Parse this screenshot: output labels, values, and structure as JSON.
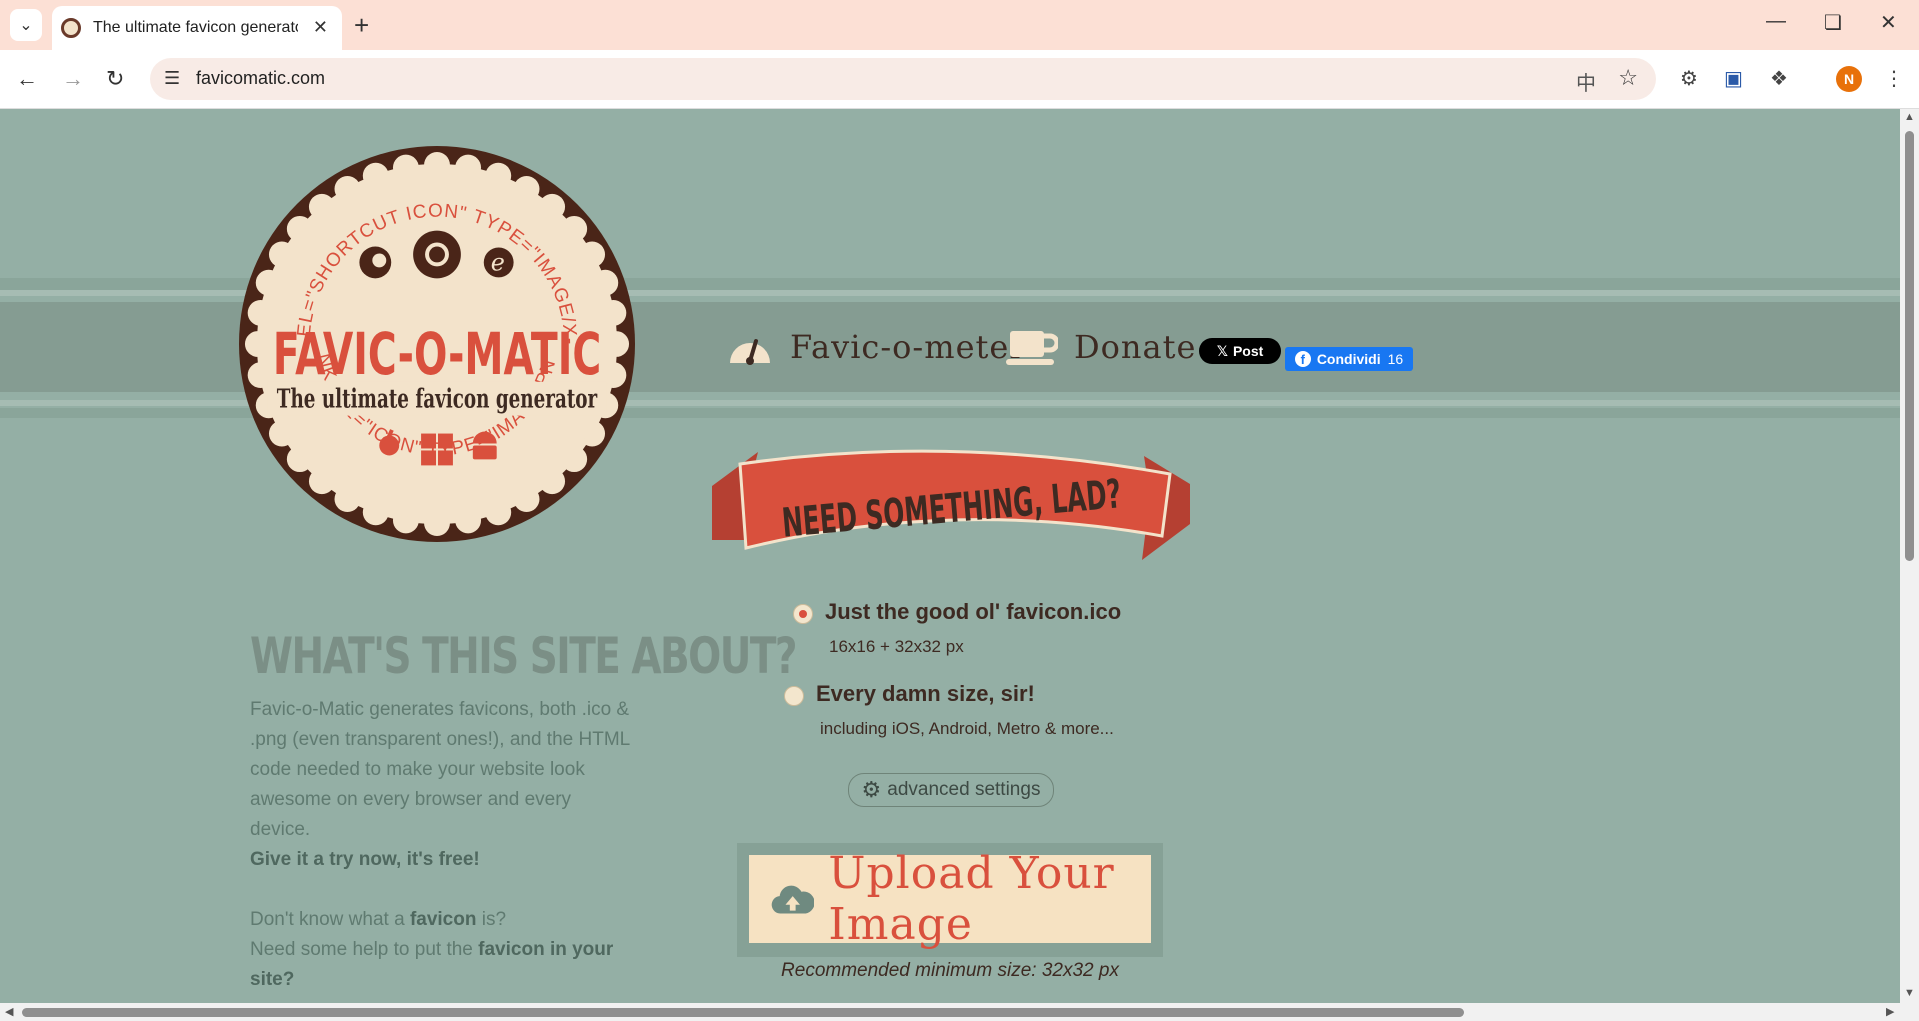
{
  "browser": {
    "tab_title": "The ultimate favicon generator",
    "url": "favicomatic.com",
    "profile_initial": "N"
  },
  "nav": {
    "faviconometer_label": "Favic-o-meter",
    "donate_label": "Donate",
    "x_post_label": "Post",
    "fb_share_label": "Condividi",
    "fb_share_count": "16"
  },
  "logo": {
    "title": "FAVIC-O-MATIC",
    "subtitle": "The ultimate favicon generator",
    "ring_top": "LINK REL=\"SHORTCUT ICON\" TYPE=\"IMAGE/X-ICON\"",
    "ring_bottom": "LINK REL=\"ICON\" TYPE=\"IMAGE/PNG\""
  },
  "banner": {
    "text": "NEED SOMETHING, LAD?"
  },
  "options": [
    {
      "title": "Just the good ol' favicon.ico",
      "subtitle": "16x16 + 32x32 px",
      "selected": true
    },
    {
      "title": "Every damn size, sir!",
      "subtitle": "including iOS, Android, Metro & more...",
      "selected": false
    }
  ],
  "advanced_settings_label": "advanced settings",
  "upload": {
    "label": "Upload Your Image",
    "recommendation": "Recommended minimum size: 32x32 px"
  },
  "about": {
    "title": "WHAT'S THIS SITE ABOUT?",
    "paragraph": "Favic-o-Matic generates favicons, both .ico & .png (even transparent ones!), and the HTML code needed to make your website look awesome on every browser and every device.",
    "cta": "Give it a try now, it's free!",
    "q1_pre": "Don't know what a ",
    "q1_bold": "favicon",
    "q1_post": " is?",
    "q2_pre": "Need some help to put the ",
    "q2_bold": "favicon in your site?"
  },
  "colors": {
    "page_bg": "#94afa5",
    "accent_red": "#d9503d",
    "dark_brown": "#3d2a22",
    "cream": "#f6e2c2",
    "tab_bar_bg": "#fce0d5"
  }
}
